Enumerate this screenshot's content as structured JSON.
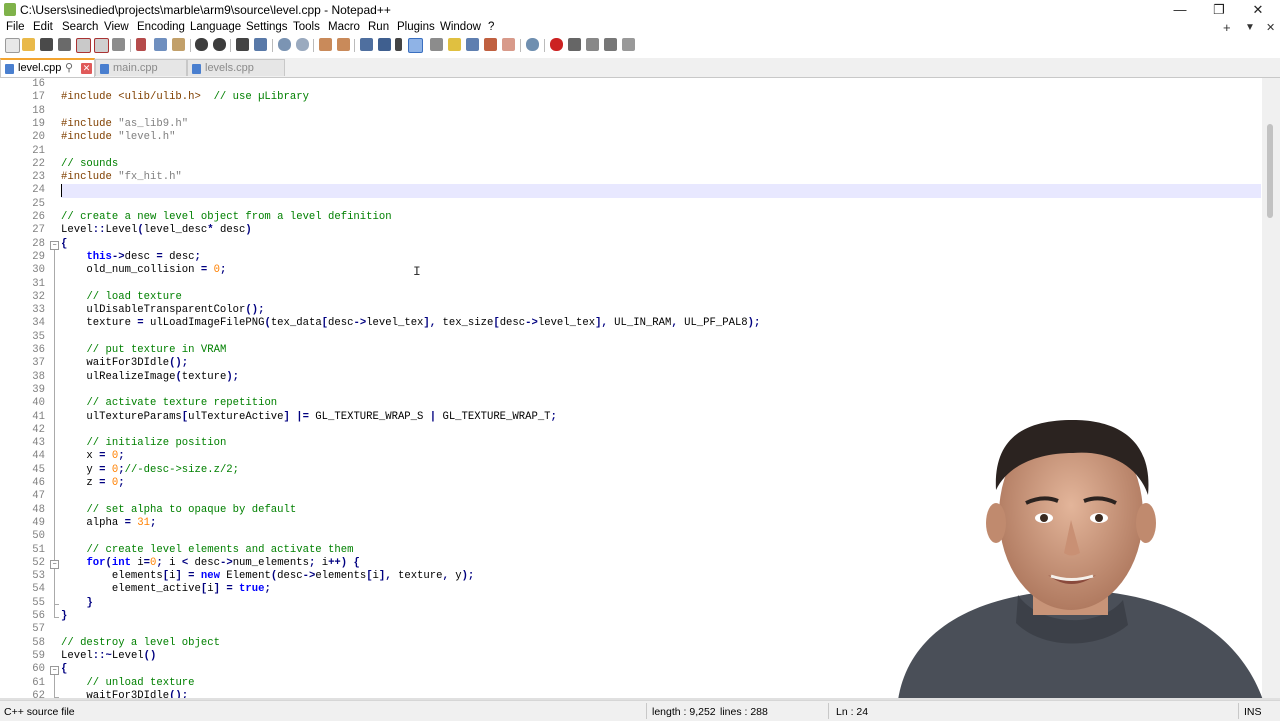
{
  "window": {
    "title": "C:\\Users\\sinedied\\projects\\marble\\arm9\\source\\level.cpp - Notepad++",
    "minimize": "—",
    "restore": "❐",
    "close": "✕"
  },
  "menu": {
    "items": [
      "File",
      "Edit",
      "Search",
      "View",
      "Encoding",
      "Language",
      "Settings",
      "Tools",
      "Macro",
      "Run",
      "Plugins",
      "Window",
      "?"
    ],
    "right": [
      "+",
      "▼",
      "✕"
    ]
  },
  "tabs": [
    {
      "label": "level.cpp",
      "active": true,
      "pin": "⚲",
      "close": "✕"
    },
    {
      "label": "main.cpp",
      "active": false
    },
    {
      "label": "levels.cpp",
      "active": false
    }
  ],
  "editor": {
    "current_line": 24,
    "lines": [
      {
        "n": "16",
        "t": []
      },
      {
        "n": "17",
        "t": [
          [
            "pp",
            "#include <ulib/ulib.h>  "
          ],
          [
            "cmt",
            "// use µLibrary"
          ]
        ]
      },
      {
        "n": "18",
        "t": []
      },
      {
        "n": "19",
        "t": [
          [
            "pp",
            "#include "
          ],
          [
            "str",
            "\"as_lib9.h\""
          ]
        ]
      },
      {
        "n": "20",
        "t": [
          [
            "pp",
            "#include "
          ],
          [
            "str",
            "\"level.h\""
          ]
        ]
      },
      {
        "n": "21",
        "t": []
      },
      {
        "n": "22",
        "t": [
          [
            "cmt",
            "// sounds"
          ]
        ]
      },
      {
        "n": "23",
        "t": [
          [
            "pp",
            "#include "
          ],
          [
            "str",
            "\"fx_hit.h\""
          ]
        ]
      },
      {
        "n": "24",
        "t": []
      },
      {
        "n": "25",
        "t": []
      },
      {
        "n": "26",
        "t": [
          [
            "cmt",
            "// create a new level object from a level definition"
          ]
        ]
      },
      {
        "n": "27",
        "t": [
          [
            "txt",
            "Level"
          ],
          [
            "op",
            "::"
          ],
          [
            "txt",
            "Level"
          ],
          [
            "op",
            "("
          ],
          [
            "txt",
            "level_desc"
          ],
          [
            "op",
            "*"
          ],
          [
            "txt",
            " desc"
          ],
          [
            "op",
            ")"
          ]
        ]
      },
      {
        "n": "28",
        "t": [
          [
            "op",
            "{"
          ]
        ]
      },
      {
        "n": "29",
        "t": [
          [
            "txt",
            "    "
          ],
          [
            "kw",
            "this"
          ],
          [
            "op",
            "->"
          ],
          [
            "txt",
            "desc "
          ],
          [
            "op",
            "="
          ],
          [
            "txt",
            " desc"
          ],
          [
            "op",
            ";"
          ]
        ]
      },
      {
        "n": "30",
        "t": [
          [
            "txt",
            "    old_num_collision "
          ],
          [
            "op",
            "="
          ],
          [
            "txt",
            " "
          ],
          [
            "num",
            "0"
          ],
          [
            "op",
            ";"
          ]
        ]
      },
      {
        "n": "31",
        "t": []
      },
      {
        "n": "32",
        "t": [
          [
            "txt",
            "    "
          ],
          [
            "cmt",
            "// load texture"
          ]
        ]
      },
      {
        "n": "33",
        "t": [
          [
            "txt",
            "    ulDisableTransparentColor"
          ],
          [
            "op",
            "();"
          ]
        ]
      },
      {
        "n": "34",
        "t": [
          [
            "txt",
            "    texture "
          ],
          [
            "op",
            "="
          ],
          [
            "txt",
            " ulLoadImageFilePNG"
          ],
          [
            "op",
            "("
          ],
          [
            "txt",
            "tex_data"
          ],
          [
            "op",
            "["
          ],
          [
            "txt",
            "desc"
          ],
          [
            "op",
            "->"
          ],
          [
            "txt",
            "level_tex"
          ],
          [
            "op",
            "],"
          ],
          [
            "txt",
            " tex_size"
          ],
          [
            "op",
            "["
          ],
          [
            "txt",
            "desc"
          ],
          [
            "op",
            "->"
          ],
          [
            "txt",
            "level_tex"
          ],
          [
            "op",
            "],"
          ],
          [
            "txt",
            " UL_IN_RAM"
          ],
          [
            "op",
            ","
          ],
          [
            "txt",
            " UL_PF_PAL8"
          ],
          [
            "op",
            ");"
          ]
        ]
      },
      {
        "n": "35",
        "t": []
      },
      {
        "n": "36",
        "t": [
          [
            "txt",
            "    "
          ],
          [
            "cmt",
            "// put texture in VRAM"
          ]
        ]
      },
      {
        "n": "37",
        "t": [
          [
            "txt",
            "    waitFor3DIdle"
          ],
          [
            "op",
            "();"
          ]
        ]
      },
      {
        "n": "38",
        "t": [
          [
            "txt",
            "    ulRealizeImage"
          ],
          [
            "op",
            "("
          ],
          [
            "txt",
            "texture"
          ],
          [
            "op",
            ");"
          ]
        ]
      },
      {
        "n": "39",
        "t": []
      },
      {
        "n": "40",
        "t": [
          [
            "txt",
            "    "
          ],
          [
            "cmt",
            "// activate texture repetition"
          ]
        ]
      },
      {
        "n": "41",
        "t": [
          [
            "txt",
            "    ulTextureParams"
          ],
          [
            "op",
            "["
          ],
          [
            "txt",
            "ulTextureActive"
          ],
          [
            "op",
            "]"
          ],
          [
            "txt",
            " "
          ],
          [
            "op",
            "|="
          ],
          [
            "txt",
            " GL_TEXTURE_WRAP_S "
          ],
          [
            "op",
            "|"
          ],
          [
            "txt",
            " GL_TEXTURE_WRAP_T"
          ],
          [
            "op",
            ";"
          ]
        ]
      },
      {
        "n": "42",
        "t": []
      },
      {
        "n": "43",
        "t": [
          [
            "txt",
            "    "
          ],
          [
            "cmt",
            "// initialize position"
          ]
        ]
      },
      {
        "n": "44",
        "t": [
          [
            "txt",
            "    x "
          ],
          [
            "op",
            "="
          ],
          [
            "txt",
            " "
          ],
          [
            "num",
            "0"
          ],
          [
            "op",
            ";"
          ]
        ]
      },
      {
        "n": "45",
        "t": [
          [
            "txt",
            "    y "
          ],
          [
            "op",
            "="
          ],
          [
            "txt",
            " "
          ],
          [
            "num",
            "0"
          ],
          [
            "op",
            ";"
          ],
          [
            "cmt",
            "//-desc->size.z/2;"
          ]
        ]
      },
      {
        "n": "46",
        "t": [
          [
            "txt",
            "    z "
          ],
          [
            "op",
            "="
          ],
          [
            "txt",
            " "
          ],
          [
            "num",
            "0"
          ],
          [
            "op",
            ";"
          ]
        ]
      },
      {
        "n": "47",
        "t": []
      },
      {
        "n": "48",
        "t": [
          [
            "txt",
            "    "
          ],
          [
            "cmt",
            "// set alpha to opaque by default"
          ]
        ]
      },
      {
        "n": "49",
        "t": [
          [
            "txt",
            "    alpha "
          ],
          [
            "op",
            "="
          ],
          [
            "txt",
            " "
          ],
          [
            "num",
            "31"
          ],
          [
            "op",
            ";"
          ]
        ]
      },
      {
        "n": "50",
        "t": []
      },
      {
        "n": "51",
        "t": [
          [
            "txt",
            "    "
          ],
          [
            "cmt",
            "// create level elements and activate them"
          ]
        ]
      },
      {
        "n": "52",
        "t": [
          [
            "txt",
            "    "
          ],
          [
            "kw",
            "for"
          ],
          [
            "op",
            "("
          ],
          [
            "kw",
            "int"
          ],
          [
            "txt",
            " i"
          ],
          [
            "op",
            "="
          ],
          [
            "num",
            "0"
          ],
          [
            "op",
            ";"
          ],
          [
            "txt",
            " i "
          ],
          [
            "op",
            "<"
          ],
          [
            "txt",
            " desc"
          ],
          [
            "op",
            "->"
          ],
          [
            "txt",
            "num_elements"
          ],
          [
            "op",
            ";"
          ],
          [
            "txt",
            " i"
          ],
          [
            "op",
            "++)"
          ],
          [
            "txt",
            " "
          ],
          [
            "op",
            "{"
          ]
        ]
      },
      {
        "n": "53",
        "t": [
          [
            "txt",
            "        elements"
          ],
          [
            "op",
            "["
          ],
          [
            "txt",
            "i"
          ],
          [
            "op",
            "]"
          ],
          [
            "txt",
            " "
          ],
          [
            "op",
            "="
          ],
          [
            "txt",
            " "
          ],
          [
            "kw",
            "new"
          ],
          [
            "txt",
            " Element"
          ],
          [
            "op",
            "("
          ],
          [
            "txt",
            "desc"
          ],
          [
            "op",
            "->"
          ],
          [
            "txt",
            "elements"
          ],
          [
            "op",
            "["
          ],
          [
            "txt",
            "i"
          ],
          [
            "op",
            "],"
          ],
          [
            "txt",
            " texture"
          ],
          [
            "op",
            ","
          ],
          [
            "txt",
            " y"
          ],
          [
            "op",
            ");"
          ]
        ]
      },
      {
        "n": "54",
        "t": [
          [
            "txt",
            "        element_active"
          ],
          [
            "op",
            "["
          ],
          [
            "txt",
            "i"
          ],
          [
            "op",
            "]"
          ],
          [
            "txt",
            " "
          ],
          [
            "op",
            "="
          ],
          [
            "txt",
            " "
          ],
          [
            "kw",
            "true"
          ],
          [
            "op",
            ";"
          ]
        ]
      },
      {
        "n": "55",
        "t": [
          [
            "txt",
            "    "
          ],
          [
            "op",
            "}"
          ]
        ]
      },
      {
        "n": "56",
        "t": [
          [
            "op",
            "}"
          ]
        ]
      },
      {
        "n": "57",
        "t": []
      },
      {
        "n": "58",
        "t": [
          [
            "cmt",
            "// destroy a level object"
          ]
        ]
      },
      {
        "n": "59",
        "t": [
          [
            "txt",
            "Level"
          ],
          [
            "op",
            "::~"
          ],
          [
            "txt",
            "Level"
          ],
          [
            "op",
            "()"
          ]
        ]
      },
      {
        "n": "60",
        "t": [
          [
            "op",
            "{"
          ]
        ]
      },
      {
        "n": "61",
        "t": [
          [
            "txt",
            "    "
          ],
          [
            "cmt",
            "// unload texture"
          ]
        ]
      },
      {
        "n": "62",
        "t": [
          [
            "txt",
            "    waitFor3DIdle"
          ],
          [
            "op",
            "();"
          ]
        ]
      }
    ]
  },
  "status": {
    "file_type": "C++ source file",
    "length": "length : 9,252",
    "lines": "lines : 288",
    "position": "Ln : 24",
    "mode": "INS"
  },
  "toolbar_icons": [
    "new-file-icon",
    "open-file-icon",
    "save-icon",
    "save-all-icon",
    "close-icon",
    "close-all-icon",
    "print-icon",
    "cut-icon",
    "copy-icon",
    "paste-icon",
    "undo-icon",
    "redo-icon",
    "find-icon",
    "replace-icon",
    "zoom-in-icon",
    "zoom-out-icon",
    "sync-v-icon",
    "sync-h-icon",
    "wrap-icon",
    "all-chars-icon",
    "indent-guide-icon",
    "udl-icon",
    "doc-map-icon",
    "func-list-icon",
    "folder-workspace-icon",
    "monitor-icon",
    "record-macro-icon",
    "stop-macro-icon",
    "play-macro-icon",
    "run-macro-multiple-icon",
    "save-macro-icon"
  ],
  "colors": {
    "comment": "#008000",
    "preprocessor": "#804000",
    "string": "#808080",
    "keyword": "#0000ff",
    "number": "#ff8000",
    "operator": "#000080",
    "current_line": "#e8e8ff",
    "active_tab_accent": "#f3a430"
  }
}
